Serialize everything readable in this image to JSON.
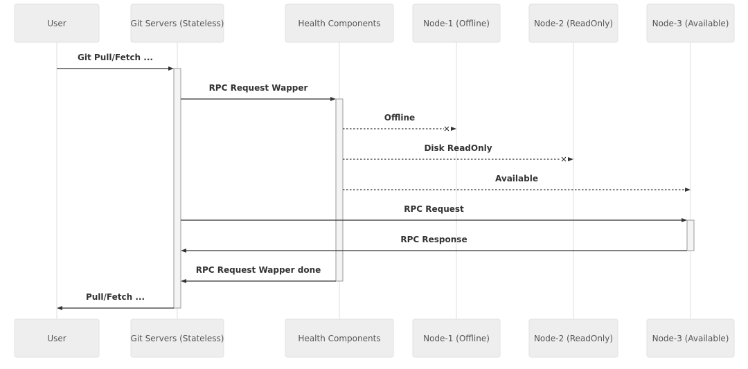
{
  "colors": {
    "box_fill": "#eeeeee",
    "box_stroke": "#e2e2e2",
    "lifeline": "#dddddd",
    "arrow": "#333333",
    "activation_fill": "#f4f4f4",
    "activation_stroke": "#999999"
  },
  "participants": [
    {
      "id": "user",
      "label": "User"
    },
    {
      "id": "git",
      "label": "Git Servers (Stateless)"
    },
    {
      "id": "health",
      "label": "Health Components"
    },
    {
      "id": "node1",
      "label": "Node-1 (Offline)"
    },
    {
      "id": "node2",
      "label": "Node-2 (ReadOnly)"
    },
    {
      "id": "node3",
      "label": "Node-3 (Available)"
    }
  ],
  "messages": [
    {
      "from": "user",
      "to": "git",
      "label": "Git Pull/Fetch ...",
      "style": "solid",
      "end": "arrow"
    },
    {
      "from": "git",
      "to": "health",
      "label": "RPC Request Wapper",
      "style": "solid",
      "end": "arrow"
    },
    {
      "from": "health",
      "to": "node1",
      "label": "Offline",
      "style": "dotted",
      "end": "cross-arrow"
    },
    {
      "from": "health",
      "to": "node2",
      "label": "Disk ReadOnly",
      "style": "dotted",
      "end": "cross-arrow"
    },
    {
      "from": "health",
      "to": "node3",
      "label": "Available",
      "style": "dotted",
      "end": "arrow"
    },
    {
      "from": "git",
      "to": "node3",
      "label": "RPC Request",
      "style": "solid",
      "end": "arrow"
    },
    {
      "from": "node3",
      "to": "git",
      "label": "RPC Response",
      "style": "solid",
      "end": "arrow"
    },
    {
      "from": "health",
      "to": "git",
      "label": "RPC Request Wapper done",
      "style": "solid",
      "end": "arrow"
    },
    {
      "from": "git",
      "to": "user",
      "label": "Pull/Fetch ...",
      "style": "solid",
      "end": "arrow"
    }
  ],
  "activations": [
    {
      "participant": "git",
      "from_message": 0,
      "to_message": 8
    },
    {
      "participant": "health",
      "from_message": 1,
      "to_message": 7
    },
    {
      "participant": "node3",
      "from_message": 5,
      "to_message": 6
    }
  ]
}
